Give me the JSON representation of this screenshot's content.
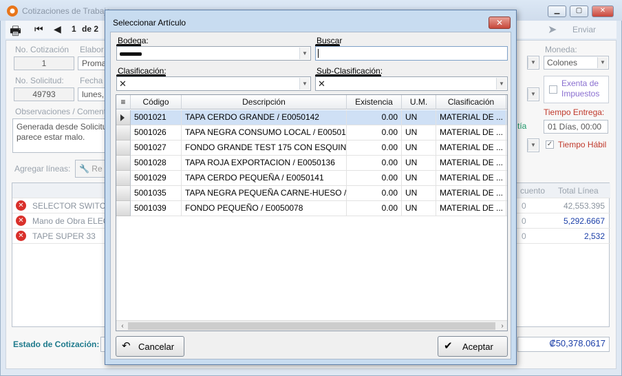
{
  "background": {
    "title": "Cotizaciones de Trabajo",
    "toolbar": {
      "page_current": "1",
      "page_of": "de 2",
      "send_label": "Enviar"
    },
    "labels": {
      "quote_no": "No. Cotización",
      "prepared": "Elabor",
      "prepared_value": "Proma",
      "request_no": "No. Solicitud:",
      "date": "Fecha",
      "date_value": "lunes,",
      "observations": "Observaciones / Coment",
      "observations_text": "Generada desde Solicitu\nparece estar malo.",
      "add_lines": "Agregar líneas:",
      "add_lines_btn": "Re",
      "currency": "Moneda:",
      "currency_value": "Colones",
      "tax_exempt": "Exenta de Impuestos",
      "delivery_time": "Tiempo Entrega:",
      "delivery_value": "01 Días, 00:00",
      "guarantee": "tía",
      "business_time": "Tiempo Hábil",
      "status_label": "Estado de Cotización:",
      "total_amount": "₡50,378.0617"
    },
    "quote_no_value": "1",
    "request_no_value": "49793",
    "grid": {
      "col_discount": "cuento",
      "col_total": "Total Línea",
      "rows": [
        {
          "desc": "SELECTOR SWITCH /",
          "discount": "0",
          "total": "42,553.395"
        },
        {
          "desc": "Mano de Obra ELEC",
          "discount": "0",
          "total": "5,292.6667"
        },
        {
          "desc": "TAPE SUPER 33",
          "discount": "0",
          "total": "2,532"
        }
      ]
    }
  },
  "dialog": {
    "title": "Seleccionar Artículo",
    "close": "✕",
    "bodega_label": "Bodega:",
    "buscar_label": "Buscar",
    "clasificacion_label": "Clasificación:",
    "subclasificacion_label": "Sub-Clasificación:",
    "clasificacion_value": "✕",
    "subclasificacion_value": "✕",
    "columns": {
      "menu": "≡",
      "code": "Código",
      "desc": "Descripción",
      "stock": "Existencia",
      "um": "U.M.",
      "class": "Clasificación"
    },
    "rows": [
      {
        "code": "5001021",
        "desc": "TAPA CERDO GRANDE / E0050142",
        "stock": "0.00",
        "um": "UN",
        "class": "MATERIAL DE ..."
      },
      {
        "code": "5001026",
        "desc": "TAPA NEGRA CONSUMO LOCAL / E00501...",
        "stock": "0.00",
        "um": "UN",
        "class": "MATERIAL DE ..."
      },
      {
        "code": "5001027",
        "desc": "FONDO GRANDE TEST 175  CON ESQUIN...",
        "stock": "0.00",
        "um": "UN",
        "class": "MATERIAL DE ..."
      },
      {
        "code": "5001028",
        "desc": "TAPA ROJA EXPORTACION  / E0050136",
        "stock": "0.00",
        "um": "UN",
        "class": "MATERIAL DE ..."
      },
      {
        "code": "5001029",
        "desc": "TAPA CERDO PEQUEÑA / E0050141",
        "stock": "0.00",
        "um": "UN",
        "class": "MATERIAL DE ..."
      },
      {
        "code": "5001035",
        "desc": "TAPA NEGRA PEQUEÑA CARNE-HUESO /...",
        "stock": "0.00",
        "um": "UN",
        "class": "MATERIAL DE ..."
      },
      {
        "code": "5001039",
        "desc": "FONDO  PEQUEÑO / E0050078",
        "stock": "0.00",
        "um": "UN",
        "class": "MATERIAL DE ..."
      }
    ],
    "cancel_label": "Cancelar",
    "accept_label": "Aceptar"
  }
}
